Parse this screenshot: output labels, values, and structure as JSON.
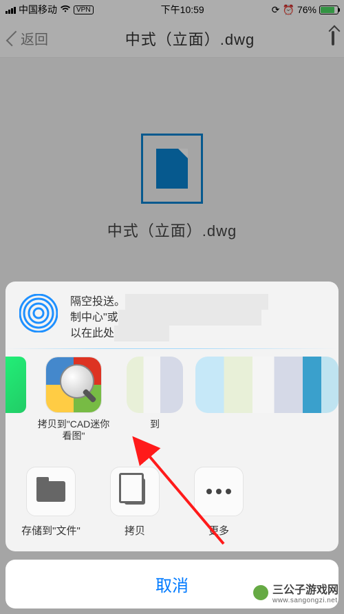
{
  "status": {
    "carrier": "中国移动",
    "vpn": "VPN",
    "time": "下午10:59",
    "battery_pct": "76%"
  },
  "nav": {
    "back": "返回",
    "title": "中式（立面）.dwg"
  },
  "file": {
    "name": "中式（立面）.dwg"
  },
  "share": {
    "airdrop": {
      "line1": "隔空投送。",
      "line2": "制中心\"或",
      "line3": "以在此处"
    },
    "apps": {
      "cad": "拷贝到\"CAD迷你看图\"",
      "next": "到"
    },
    "actions": {
      "files": "存储到\"文件\"",
      "copy": "拷贝",
      "more": "更多"
    },
    "cancel": "取消"
  },
  "watermark": {
    "name": "三公子游戏网",
    "url": "www.sangongzi.net"
  }
}
